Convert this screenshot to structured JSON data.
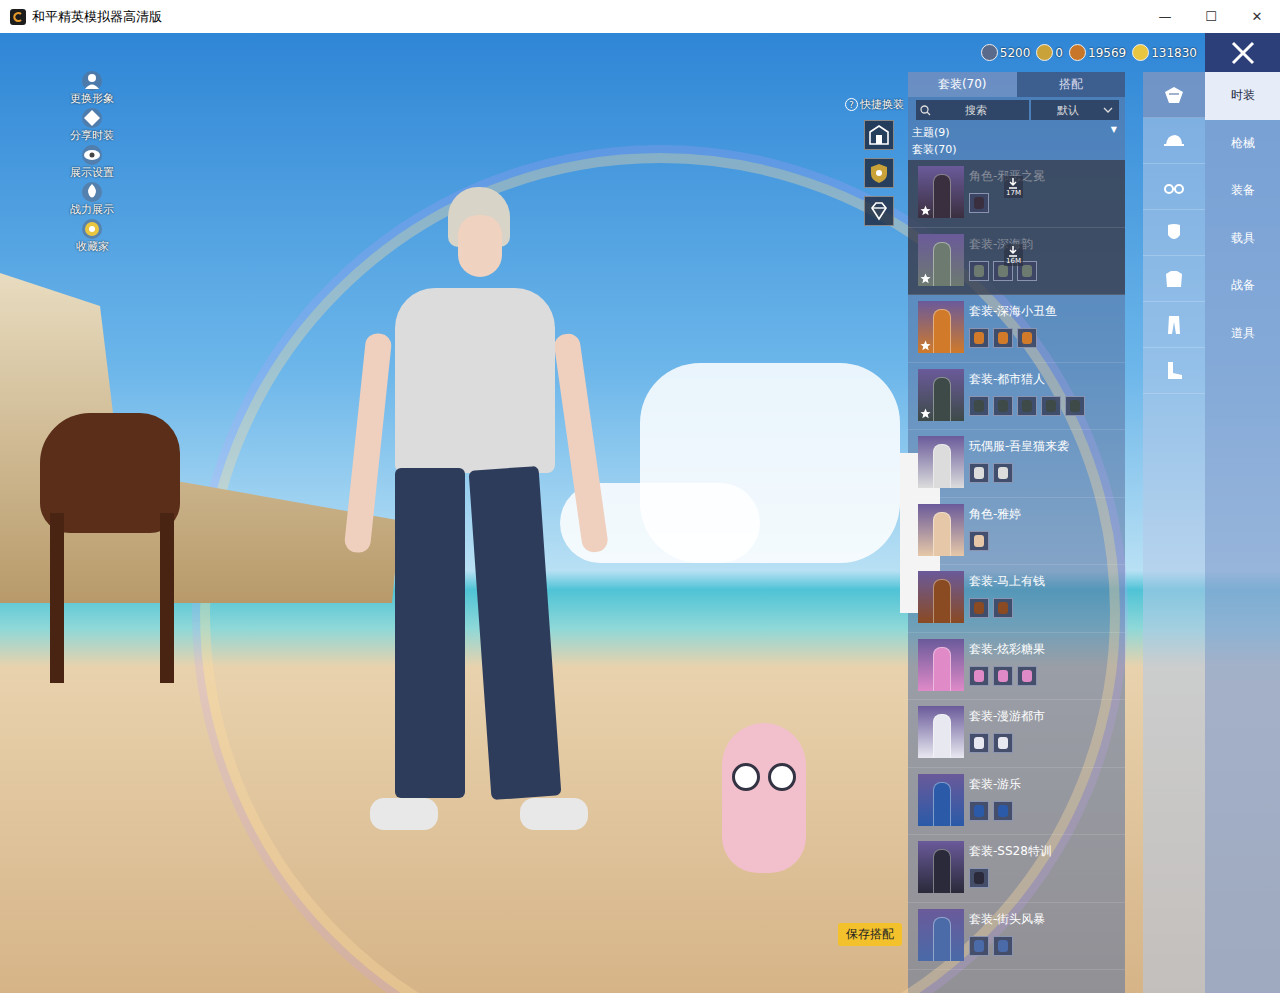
{
  "window": {
    "title": "和平精英模拟器高清版",
    "controls": [
      "—",
      "☐",
      "✕"
    ]
  },
  "currencies": [
    {
      "amount": "5200",
      "color": "#5a6a8a"
    },
    {
      "amount": "0",
      "color": "#c9a23a"
    },
    {
      "amount": "19569",
      "color": "#c8772a"
    },
    {
      "amount": "131830",
      "color": "#e8c640"
    }
  ],
  "side_menu": [
    {
      "label": "更换形象"
    },
    {
      "label": "分享时装"
    },
    {
      "label": "展示设置"
    },
    {
      "label": "战力展示"
    },
    {
      "label": "收藏家"
    }
  ],
  "quick_change": {
    "label": "快捷换装",
    "help": "?"
  },
  "panel": {
    "tabs": [
      {
        "label": "套装(70)",
        "selected": true
      },
      {
        "label": "搭配",
        "selected": false
      }
    ],
    "search": {
      "placeholder": "搜索"
    },
    "sort": {
      "value": "默认"
    },
    "theme_filter": {
      "label": "主题(9)",
      "arrow": "▼"
    },
    "list_title": "套装(70)",
    "outfits": [
      {
        "title": "角色-邪恶之冕",
        "parts": 1,
        "starred": true,
        "dimmed": true,
        "download": "17M",
        "color": "#3a2f3f"
      },
      {
        "title": "套装-深海韵",
        "parts": 3,
        "starred": true,
        "dimmed": true,
        "download": "16M",
        "color": "#6d7a70"
      },
      {
        "title": "套装-深海小丑鱼",
        "parts": 3,
        "starred": true,
        "dimmed": false,
        "download": "",
        "color": "#d07a2a"
      },
      {
        "title": "套装-都市猎人",
        "parts": 5,
        "starred": true,
        "dimmed": false,
        "download": "",
        "color": "#3d4a48"
      },
      {
        "title": "玩偶服-吾皇猫来袭",
        "parts": 2,
        "starred": false,
        "dimmed": false,
        "download": "",
        "color": "#dcdcdc"
      },
      {
        "title": "角色-雅婷",
        "parts": 1,
        "starred": false,
        "dimmed": false,
        "download": "",
        "color": "#e6c8a8"
      },
      {
        "title": "套装-马上有钱",
        "parts": 2,
        "starred": false,
        "dimmed": false,
        "download": "",
        "color": "#8a4a22"
      },
      {
        "title": "套装-炫彩糖果",
        "parts": 3,
        "starred": false,
        "dimmed": false,
        "download": "",
        "color": "#e08ac8"
      },
      {
        "title": "套装-漫游都市",
        "parts": 2,
        "starred": false,
        "dimmed": false,
        "download": "",
        "color": "#e8e8f0"
      },
      {
        "title": "套装-游乐",
        "parts": 2,
        "starred": false,
        "dimmed": false,
        "download": "",
        "color": "#2a5aa8"
      },
      {
        "title": "套装-SS28特训",
        "parts": 1,
        "starred": false,
        "dimmed": false,
        "download": "",
        "color": "#2a2a3a"
      },
      {
        "title": "套装-街头风暴",
        "parts": 2,
        "starred": false,
        "dimmed": false,
        "download": "",
        "color": "#4a6aa8"
      }
    ]
  },
  "categories": [
    {
      "selected": true
    },
    {
      "selected": false
    },
    {
      "selected": false
    },
    {
      "selected": false
    },
    {
      "selected": false
    },
    {
      "selected": false
    },
    {
      "selected": false
    }
  ],
  "nav": [
    {
      "label": "时装",
      "selected": true
    },
    {
      "label": "枪械",
      "selected": false
    },
    {
      "label": "装备",
      "selected": false
    },
    {
      "label": "载具",
      "selected": false
    },
    {
      "label": "战备",
      "selected": false
    },
    {
      "label": "道具",
      "selected": false
    }
  ],
  "save_button": "保存搭配"
}
